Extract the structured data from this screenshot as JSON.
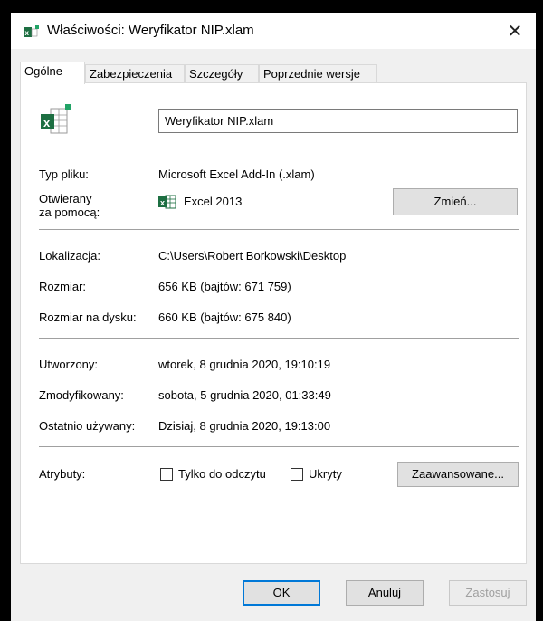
{
  "window": {
    "title": "Właściwości: Weryfikator NIP.xlam",
    "close_glyph": "✕"
  },
  "tabs": [
    {
      "label": "Ogólne",
      "active": true
    },
    {
      "label": "Zabezpieczenia",
      "active": false
    },
    {
      "label": "Szczegóły",
      "active": false
    },
    {
      "label": "Poprzednie wersje",
      "active": false
    }
  ],
  "general": {
    "file_icon": "excel-file-icon",
    "file_name": "Weryfikator NIP.xlam",
    "type_label": "Typ pliku:",
    "type_value": "Microsoft Excel Add-In (.xlam)",
    "opens_with_label_1": "Otwierany",
    "opens_with_label_2": "za pomocą:",
    "opens_with_icon": "excel-app-icon",
    "opens_with_value": "Excel 2013",
    "change_button": "Zmień...",
    "location_label": "Lokalizacja:",
    "location_value": "C:\\Users\\Robert Borkowski\\Desktop",
    "size_label": "Rozmiar:",
    "size_value": "656 KB (bajtów: 671 759)",
    "disk_size_label": "Rozmiar na dysku:",
    "disk_size_value": "660 KB (bajtów: 675 840)",
    "created_label": "Utworzony:",
    "created_value": "wtorek, 8 grudnia 2020, 19:10:19",
    "modified_label": "Zmodyfikowany:",
    "modified_value": "sobota, 5 grudnia 2020, 01:33:49",
    "accessed_label": "Ostatnio używany:",
    "accessed_value": "Dzisiaj, 8 grudnia 2020, 19:13:00",
    "attributes_label": "Atrybuty:",
    "readonly_label": "Tylko do odczytu",
    "readonly_checked": false,
    "hidden_label": "Ukryty",
    "hidden_checked": false,
    "advanced_button": "Zaawansowane..."
  },
  "footer": {
    "ok": "OK",
    "cancel": "Anuluj",
    "apply": "Zastosuj"
  },
  "colors": {
    "excel_green": "#1d6f42",
    "accent_border": "#0078d7",
    "disabled_text": "#a0a0a0"
  }
}
